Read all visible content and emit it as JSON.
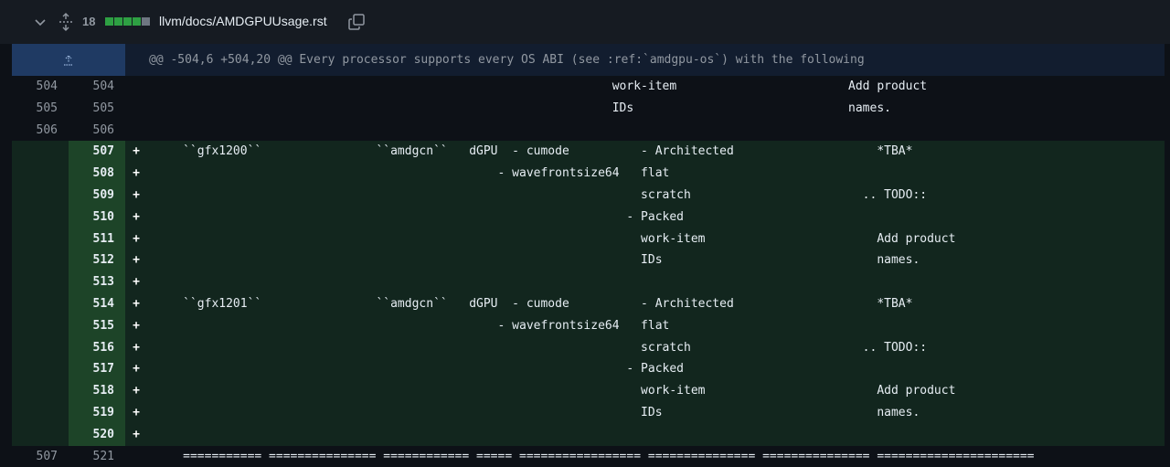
{
  "file": {
    "change_count": "18",
    "path": "llvm/docs/AMDGPUUsage.rst",
    "diffstat": [
      "#2ea043",
      "#2ea043",
      "#2ea043",
      "#2ea043",
      "#6e7681"
    ]
  },
  "hunk": {
    "header": "@@ -504,6 +504,20 @@ Every processor supports every OS ABI (see :ref:`amdgpu-os`) with the following"
  },
  "lines": [
    {
      "type": "ctx",
      "old": "504",
      "new": "504",
      "marker": "",
      "code": "                                                                 work-item                        Add product"
    },
    {
      "type": "ctx",
      "old": "505",
      "new": "505",
      "marker": "",
      "code": "                                                                 IDs                              names."
    },
    {
      "type": "ctx",
      "old": "506",
      "new": "506",
      "marker": "",
      "code": ""
    },
    {
      "type": "add",
      "old": "",
      "new": "507",
      "marker": "+",
      "code": "     ``gfx1200``                ``amdgcn``   dGPU  - cumode          - Architected                    *TBA*"
    },
    {
      "type": "add",
      "old": "",
      "new": "508",
      "marker": "+",
      "code": "                                                 - wavefrontsize64   flat"
    },
    {
      "type": "add",
      "old": "",
      "new": "509",
      "marker": "+",
      "code": "                                                                     scratch                        .. TODO::"
    },
    {
      "type": "add",
      "old": "",
      "new": "510",
      "marker": "+",
      "code": "                                                                   - Packed"
    },
    {
      "type": "add",
      "old": "",
      "new": "511",
      "marker": "+",
      "code": "                                                                     work-item                        Add product"
    },
    {
      "type": "add",
      "old": "",
      "new": "512",
      "marker": "+",
      "code": "                                                                     IDs                              names."
    },
    {
      "type": "add",
      "old": "",
      "new": "513",
      "marker": "+",
      "code": ""
    },
    {
      "type": "add",
      "old": "",
      "new": "514",
      "marker": "+",
      "code": "     ``gfx1201``                ``amdgcn``   dGPU  - cumode          - Architected                    *TBA*"
    },
    {
      "type": "add",
      "old": "",
      "new": "515",
      "marker": "+",
      "code": "                                                 - wavefrontsize64   flat"
    },
    {
      "type": "add",
      "old": "",
      "new": "516",
      "marker": "+",
      "code": "                                                                     scratch                        .. TODO::"
    },
    {
      "type": "add",
      "old": "",
      "new": "517",
      "marker": "+",
      "code": "                                                                   - Packed"
    },
    {
      "type": "add",
      "old": "",
      "new": "518",
      "marker": "+",
      "code": "                                                                     work-item                        Add product"
    },
    {
      "type": "add",
      "old": "",
      "new": "519",
      "marker": "+",
      "code": "                                                                     IDs                              names."
    },
    {
      "type": "add",
      "old": "",
      "new": "520",
      "marker": "+",
      "code": ""
    },
    {
      "type": "ctx",
      "old": "507",
      "new": "521",
      "marker": "",
      "code": "     =========== =============== ============ ===== ================= =============== =============== ======================"
    }
  ]
}
